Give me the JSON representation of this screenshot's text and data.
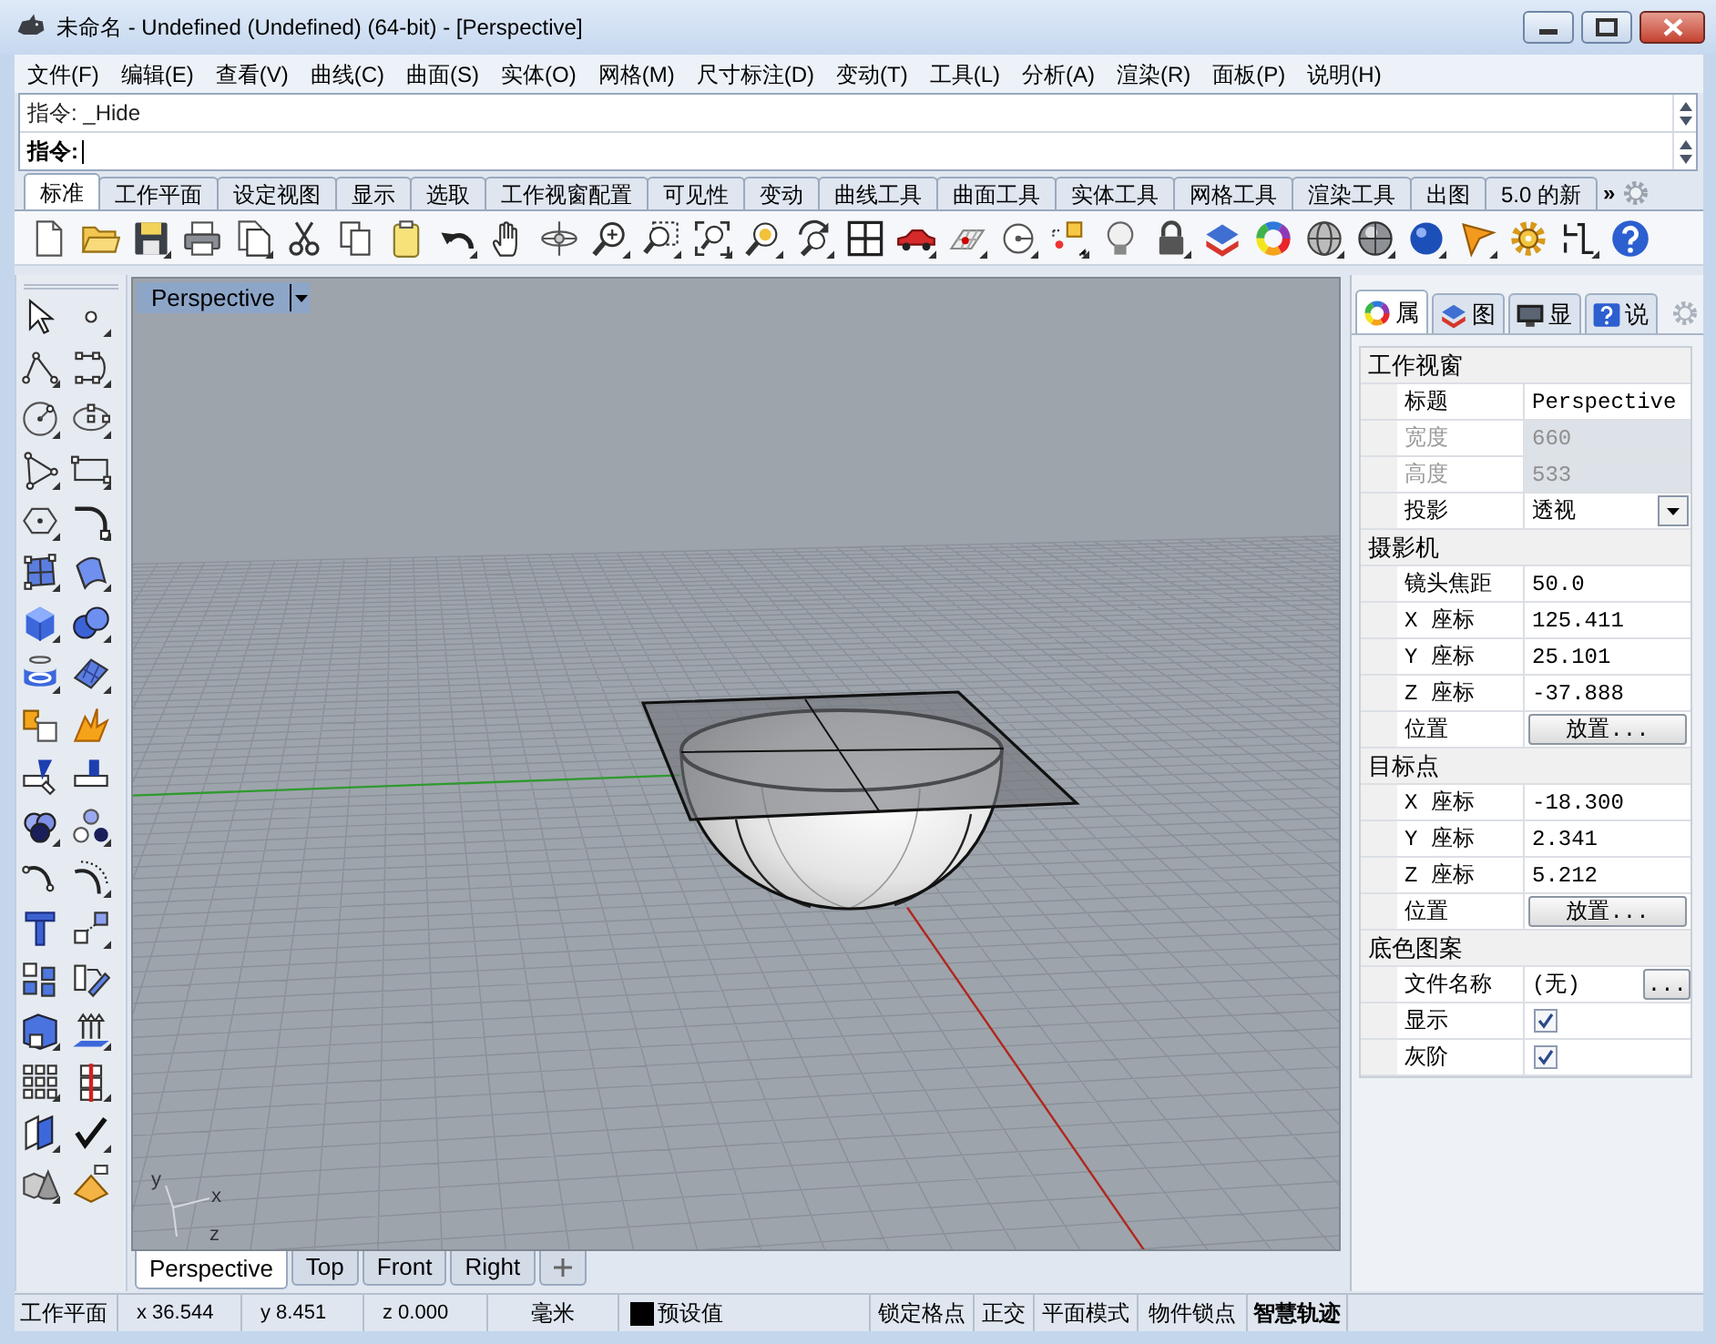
{
  "window": {
    "title": "未命名 - Undefined (Undefined) (64-bit) - [Perspective]"
  },
  "menu": [
    "文件(F)",
    "编辑(E)",
    "查看(V)",
    "曲线(C)",
    "曲面(S)",
    "实体(O)",
    "网格(M)",
    "尺寸标注(D)",
    "变动(T)",
    "工具(L)",
    "分析(A)",
    "渲染(R)",
    "面板(P)",
    "说明(H)"
  ],
  "command": {
    "history": [
      "指令: _Hide"
    ],
    "prompt": "指令:"
  },
  "toolbar_tabs": [
    {
      "label": "标准",
      "selected": true
    },
    {
      "label": "工作平面",
      "selected": false
    },
    {
      "label": "设定视图",
      "selected": false
    },
    {
      "label": "显示",
      "selected": false
    },
    {
      "label": "选取",
      "selected": false
    },
    {
      "label": "工作视窗配置",
      "selected": false
    },
    {
      "label": "可见性",
      "selected": false
    },
    {
      "label": "变动",
      "selected": false
    },
    {
      "label": "曲线工具",
      "selected": false
    },
    {
      "label": "曲面工具",
      "selected": false
    },
    {
      "label": "实体工具",
      "selected": false
    },
    {
      "label": "网格工具",
      "selected": false
    },
    {
      "label": "渲染工具",
      "selected": false
    },
    {
      "label": "出图",
      "selected": false
    },
    {
      "label": "5.0 的新",
      "selected": false
    }
  ],
  "toolbar_tabs_overflow": "»",
  "viewport": {
    "title": "Perspective",
    "axis_labels": [
      "y",
      "x",
      "z"
    ]
  },
  "viewport_tabs": [
    {
      "label": "Perspective",
      "selected": true
    },
    {
      "label": "Top",
      "selected": false
    },
    {
      "label": "Front",
      "selected": false
    },
    {
      "label": "Right",
      "selected": false
    }
  ],
  "panel": {
    "tabs": [
      {
        "label": "属",
        "selected": true
      },
      {
        "label": "图",
        "selected": false
      },
      {
        "label": "显",
        "selected": false
      },
      {
        "label": "说",
        "selected": false
      }
    ],
    "sections": [
      {
        "title": "工作视窗",
        "rows": [
          {
            "label": "标题",
            "kind": "text",
            "value": "Perspective",
            "disabled": false
          },
          {
            "label": "宽度",
            "kind": "text",
            "value": "660",
            "disabled": true
          },
          {
            "label": "高度",
            "kind": "text",
            "value": "533",
            "disabled": true
          },
          {
            "label": "投影",
            "kind": "dropdown",
            "value": "透视",
            "disabled": false
          }
        ]
      },
      {
        "title": "摄影机",
        "rows": [
          {
            "label": "镜头焦距",
            "kind": "text",
            "value": "50.0",
            "disabled": false
          },
          {
            "label": "X 座标",
            "kind": "text",
            "value": "125.411",
            "disabled": false
          },
          {
            "label": "Y 座标",
            "kind": "text",
            "value": "25.101",
            "disabled": false
          },
          {
            "label": "Z 座标",
            "kind": "text",
            "value": "-37.888",
            "disabled": false
          },
          {
            "label": "位置",
            "kind": "button",
            "value": "放置...",
            "disabled": false
          }
        ]
      },
      {
        "title": "目标点",
        "rows": [
          {
            "label": "X 座标",
            "kind": "text",
            "value": "-18.300",
            "disabled": false
          },
          {
            "label": "Y 座标",
            "kind": "text",
            "value": "2.341",
            "disabled": false
          },
          {
            "label": "Z 座标",
            "kind": "text",
            "value": "5.212",
            "disabled": false
          },
          {
            "label": "位置",
            "kind": "button",
            "value": "放置...",
            "disabled": false
          }
        ]
      },
      {
        "title": "底色图案",
        "rows": [
          {
            "label": "文件名称",
            "kind": "file",
            "value": "(无)",
            "button": "...",
            "disabled": false
          },
          {
            "label": "显示",
            "kind": "checkbox",
            "checked": true,
            "disabled": false
          },
          {
            "label": "灰阶",
            "kind": "checkbox",
            "checked": true,
            "disabled": false
          }
        ]
      }
    ]
  },
  "status_bar": {
    "cplane": "工作平面",
    "x": "x 36.544",
    "y": "y 8.451",
    "z": "z 0.000",
    "units": "毫米",
    "layer": {
      "name": "预设值",
      "color": "#000000"
    },
    "toggles": [
      {
        "label": "锁定格点",
        "on": false
      },
      {
        "label": "正交",
        "on": false
      },
      {
        "label": "平面模式",
        "on": false
      },
      {
        "label": "物件锁点",
        "on": false
      },
      {
        "label": "智慧轨迹",
        "on": true
      }
    ]
  }
}
